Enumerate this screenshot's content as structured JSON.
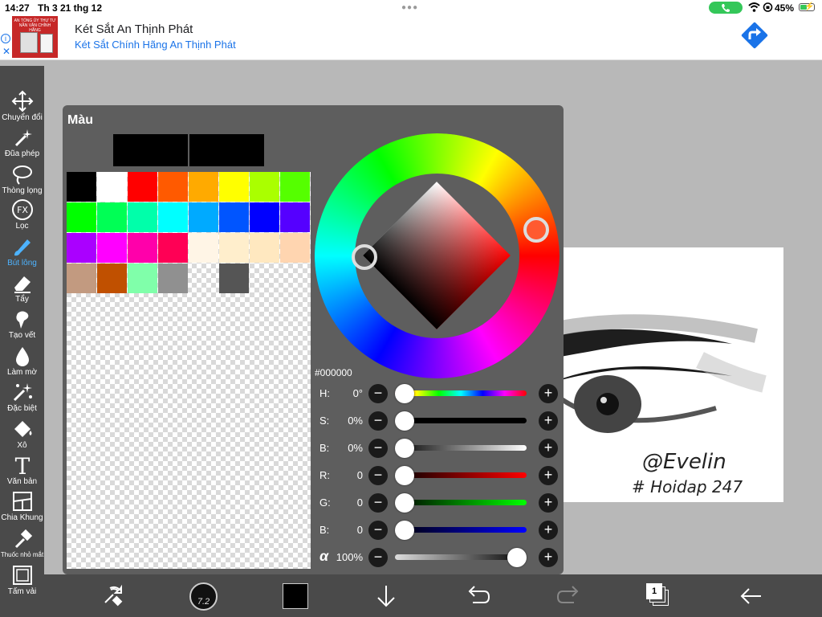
{
  "status": {
    "time": "14:27",
    "date": "Th 3 21 thg 12",
    "battery": "45%"
  },
  "ad": {
    "title": "Két Sắt An Thịnh Phát",
    "subtitle": "Két Sắt Chính Hãng An Thịnh Phát",
    "thumb_text": "AN TỔNG ỦY THỰ TƯ NẦN VÂN CHỈNH HÃNG"
  },
  "tools": [
    {
      "label": "Chuyển đổi",
      "icon": "move-icon"
    },
    {
      "label": "Đũa phép",
      "icon": "magic-wand-icon"
    },
    {
      "label": "Thòng lọng",
      "icon": "lasso-icon"
    },
    {
      "label": "Lọc",
      "icon": "fx-filter-icon",
      "glyph": "FX"
    },
    {
      "label": "Bút lông",
      "icon": "brush-icon",
      "active": true
    },
    {
      "label": "Tẩy",
      "icon": "eraser-icon"
    },
    {
      "label": "Tạo vết",
      "icon": "smudge-icon"
    },
    {
      "label": "Làm mờ",
      "icon": "blur-icon"
    },
    {
      "label": "Đặc biệt",
      "icon": "special-icon"
    },
    {
      "label": "Xô",
      "icon": "bucket-icon"
    },
    {
      "label": "Văn bản",
      "icon": "text-icon",
      "glyph": "T"
    },
    {
      "label": "Chia Khung",
      "icon": "frame-divide-icon"
    },
    {
      "label": "Thuốc nhỏ mắt",
      "icon": "eyedropper-icon"
    },
    {
      "label": "Tấm vải",
      "icon": "canvas-icon"
    }
  ],
  "panel": {
    "title": "Màu",
    "hex": "#000000",
    "current_color": "#000000",
    "palette": [
      "#000000",
      "#ffffff",
      "#ff0000",
      "#ff5a00",
      "#ffaa00",
      "#ffff00",
      "#aaff00",
      "#55ff00",
      "#00ff00",
      "#00ff55",
      "#00ffaa",
      "#00ffff",
      "#00aaff",
      "#0055ff",
      "#0000ff",
      "#5500ff",
      "#aa00ff",
      "#ff00ff",
      "#ff00aa",
      "#ff0055",
      "#fff5e6",
      "#ffeecc",
      "#ffe8c0",
      "#ffd5b0",
      "#c29a80",
      "#c05000",
      "#80ffaa",
      "#909090",
      "",
      "#555555"
    ],
    "sliders": [
      {
        "name": "H:",
        "value": "0°",
        "level": 0,
        "track": "hue"
      },
      {
        "name": "S:",
        "value": "0%",
        "level": 0,
        "track": "sat"
      },
      {
        "name": "B:",
        "value": "0%",
        "level": 0,
        "track": "bri"
      },
      {
        "name": "R:",
        "value": "0",
        "level": 0,
        "track": "red"
      },
      {
        "name": "G:",
        "value": "0",
        "level": 0,
        "track": "green"
      },
      {
        "name": "B:",
        "value": "0",
        "level": 0,
        "track": "blue"
      },
      {
        "name": "α",
        "value": "100%",
        "level": 1,
        "track": "alpha"
      }
    ]
  },
  "canvas": {
    "signature": "@Evelin",
    "tag": "# Hoidap 247"
  },
  "bottom": {
    "brush_size": "7.2",
    "layer_count": "1"
  }
}
